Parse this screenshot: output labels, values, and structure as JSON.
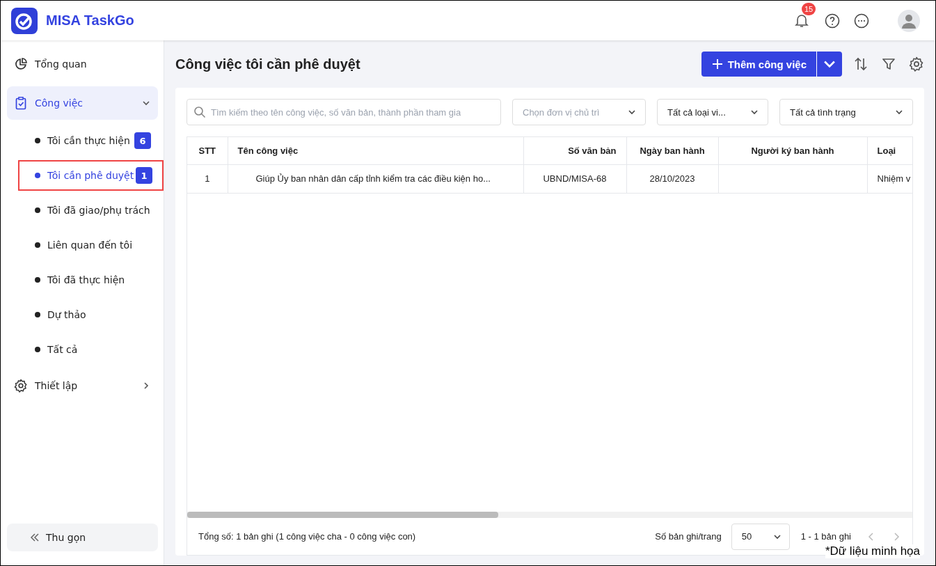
{
  "app": {
    "name": "MISA TaskGo"
  },
  "header": {
    "notification_count": "15"
  },
  "sidebar": {
    "items": [
      {
        "kind": "overview",
        "label": "Tổng quan",
        "expanded": false,
        "selected": false
      },
      {
        "kind": "tasks",
        "label": "Công việc",
        "expanded": true,
        "selected": true,
        "children": [
          {
            "label": "Tôi cần thực hiện",
            "count": "6",
            "selected": false,
            "highlighted": false
          },
          {
            "label": "Tôi cần phê duyệt",
            "count": "1",
            "selected": true,
            "highlighted": true
          },
          {
            "label": "Tôi đã giao/phụ trách",
            "selected": false,
            "highlighted": false
          },
          {
            "label": "Liên quan đến tôi",
            "selected": false,
            "highlighted": false
          },
          {
            "label": "Tôi đã thực hiện",
            "selected": false,
            "highlighted": false
          },
          {
            "label": "Dự thảo",
            "selected": false,
            "highlighted": false
          },
          {
            "label": "Tất cả",
            "selected": false,
            "highlighted": false
          }
        ]
      },
      {
        "kind": "settings",
        "label": "Thiết lập",
        "expanded": false,
        "selected": false
      }
    ],
    "collapse": "Thu gọn"
  },
  "page": {
    "title": "Công việc tôi cần phê duyệt",
    "add_button": "Thêm công việc"
  },
  "filters": {
    "search": {
      "placeholder": "Tìm kiếm theo tên công việc, số văn bản, thành phần tham gia"
    },
    "dropdowns": [
      {
        "placeholder": "Chọn đơn vị chủ trì"
      },
      {
        "value": "Tất cả loại vi..."
      },
      {
        "value": "Tất cả tình trạng"
      }
    ]
  },
  "table": {
    "columns": [
      {
        "label": "STT"
      },
      {
        "label": "Tên công việc"
      },
      {
        "label": "Số văn bản"
      },
      {
        "label": "Ngày ban hành"
      },
      {
        "label": "Người ký ban hành"
      },
      {
        "label": "Loại"
      }
    ],
    "rows": [
      {
        "cells": [
          "1",
          "Giúp Ủy ban nhân dân cấp tỉnh kiểm tra các điều kiện ho...",
          "UBND/MISA-68",
          "28/10/2023",
          "",
          "Nhiệm v"
        ]
      }
    ]
  },
  "footer": {
    "summary": "Tổng số: 1 bản ghi (1 công việc cha - 0 công việc con)",
    "page_size_label": "Số bản ghi/trang",
    "page_size": "50",
    "range": "1 - 1 bản ghi"
  },
  "note": "*Dữ liệu minh họa"
}
